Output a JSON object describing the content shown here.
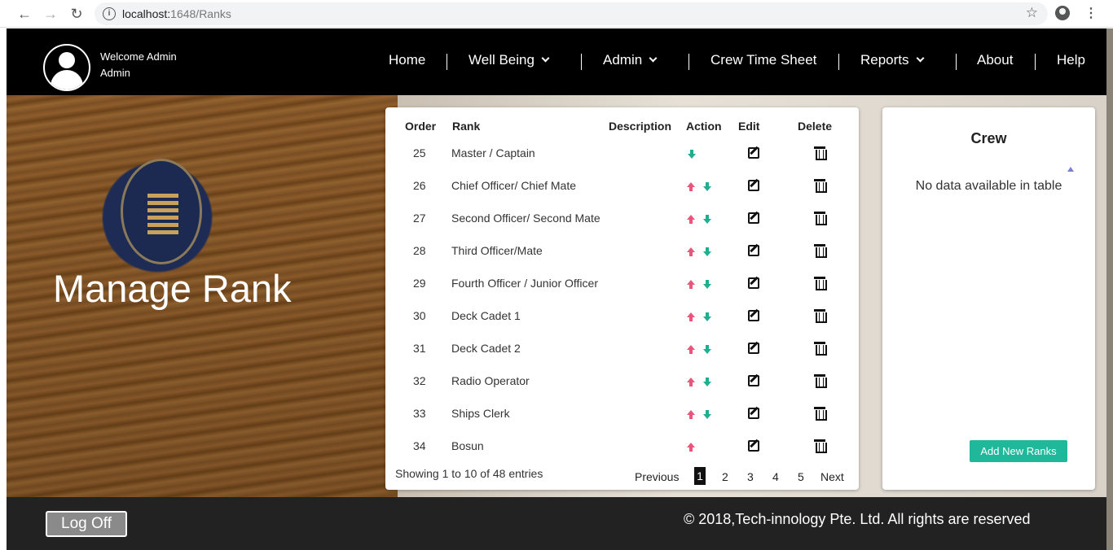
{
  "browser": {
    "url_host": "localhost:",
    "url_port_path": "1648/Ranks"
  },
  "header": {
    "welcome": "Welcome Admin",
    "username": "Admin",
    "nav": [
      {
        "label": "Home",
        "has_dropdown": false
      },
      {
        "label": "Well Being",
        "has_dropdown": true
      },
      {
        "label": "Admin",
        "has_dropdown": true
      },
      {
        "label": "Crew Time Sheet",
        "has_dropdown": false
      },
      {
        "label": "Reports",
        "has_dropdown": true
      },
      {
        "label": "About",
        "has_dropdown": false
      },
      {
        "label": "Help",
        "has_dropdown": false
      }
    ]
  },
  "page": {
    "title": "Manage Rank"
  },
  "table": {
    "headers": [
      "Order",
      "Rank",
      "Description",
      "Action",
      "Edit",
      "Delete"
    ],
    "rows": [
      {
        "order": "25",
        "rank": "Master / Captain",
        "description": "",
        "up": false,
        "down": true
      },
      {
        "order": "26",
        "rank": "Chief Officer/ Chief Mate",
        "description": "",
        "up": true,
        "down": true
      },
      {
        "order": "27",
        "rank": "Second Officer/ Second Mate",
        "description": "",
        "up": true,
        "down": true
      },
      {
        "order": "28",
        "rank": "Third Officer/Mate",
        "description": "",
        "up": true,
        "down": true
      },
      {
        "order": "29",
        "rank": "Fourth Officer / Junior Officer",
        "description": "",
        "up": true,
        "down": true
      },
      {
        "order": "30",
        "rank": "Deck Cadet 1",
        "description": "",
        "up": true,
        "down": true
      },
      {
        "order": "31",
        "rank": "Deck Cadet 2",
        "description": "",
        "up": true,
        "down": true
      },
      {
        "order": "32",
        "rank": "Radio Operator",
        "description": "",
        "up": true,
        "down": true
      },
      {
        "order": "33",
        "rank": "Ships Clerk",
        "description": "",
        "up": true,
        "down": true
      },
      {
        "order": "34",
        "rank": "Bosun",
        "description": "",
        "up": true,
        "down": false
      }
    ],
    "info": "Showing 1 to 10 of 48 entries",
    "pagination": {
      "previous": "Previous",
      "pages": [
        "1",
        "2",
        "3",
        "4",
        "5"
      ],
      "active": "1",
      "next": "Next"
    }
  },
  "crew": {
    "title": "Crew",
    "empty": "No data available in table",
    "add_button": "Add New Ranks"
  },
  "footer": {
    "logoff": "Log Off",
    "copyright": "© 2018,Tech-innology Pte. Ltd. All rights are reserved"
  },
  "colors": {
    "up_arrow": "#e8567a",
    "down_arrow": "#1fae8f",
    "add_button": "#1fb89a"
  }
}
